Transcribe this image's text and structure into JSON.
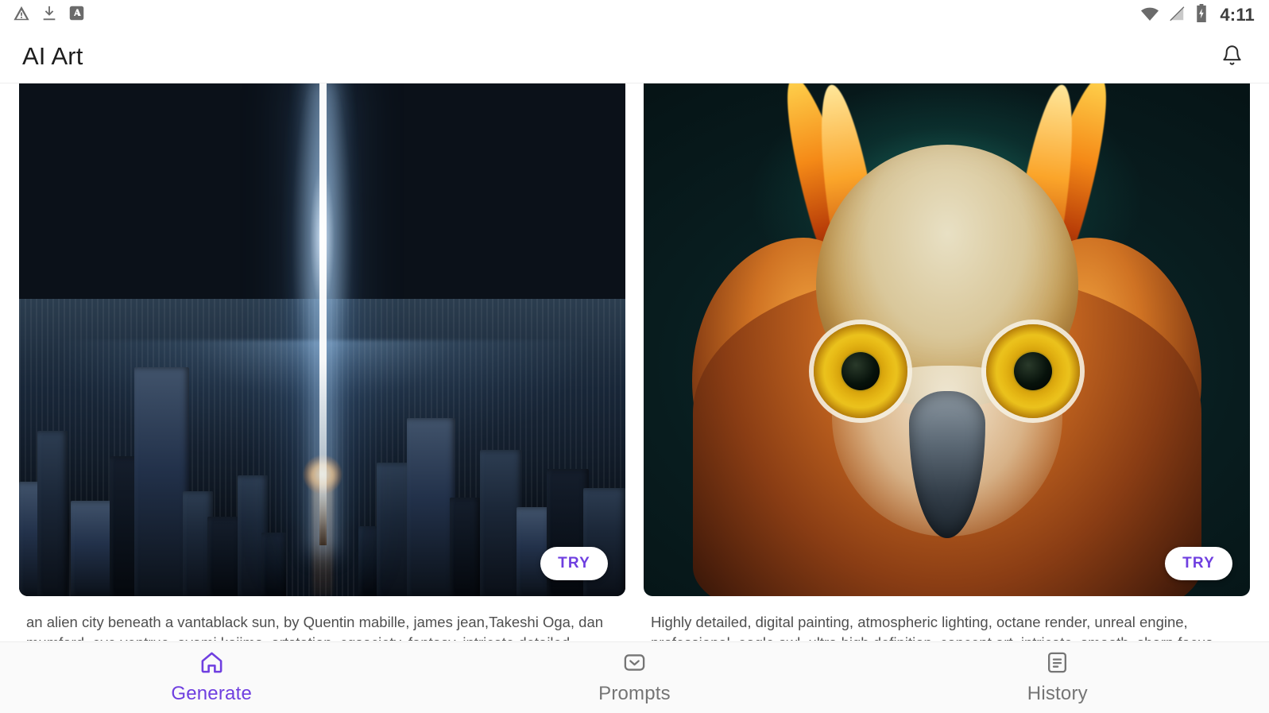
{
  "status_bar": {
    "left_icons": [
      {
        "name": "warning-triangle-icon",
        "label": "warning"
      },
      {
        "name": "download-icon",
        "label": "download"
      },
      {
        "name": "app-a-icon",
        "label": "A"
      }
    ],
    "right_icons": [
      {
        "name": "wifi-icon",
        "label": "wifi"
      },
      {
        "name": "no-signal-icon",
        "label": "no signal"
      },
      {
        "name": "battery-charging-icon",
        "label": "battery charging"
      }
    ],
    "time": "4:11"
  },
  "app_bar": {
    "title": "AI Art",
    "notification_icon": "bell-icon"
  },
  "gallery": {
    "cards": [
      {
        "id": "alien-city",
        "alt": "an alien city beneath a vantablack sun with a vertical beam of light",
        "try_label": "TRY",
        "caption": "an alien city beneath a vantablack sun, by Quentin mabille, james jean,Takeshi Oga, dan mumford, eve ventrue, ayami kojima, artstation, cgsociety, fantasy, intricate detailed, scaffolding"
      },
      {
        "id": "eagle-owl",
        "alt": "highly detailed digital painting of an eagle owl",
        "try_label": "TRY",
        "caption": "Highly detailed, digital painting, atmospheric lighting, octane render, unreal engine, professional, eagle owl, ultra high definition, concept art, intricate, smooth, sharp focus, illustration"
      }
    ]
  },
  "bottom_nav": {
    "items": [
      {
        "id": "generate",
        "label": "Generate",
        "icon": "home-icon",
        "active": true
      },
      {
        "id": "prompts",
        "label": "Prompts",
        "icon": "chevron-box-icon",
        "active": false
      },
      {
        "id": "history",
        "label": "History",
        "icon": "document-list-icon",
        "active": false
      }
    ]
  },
  "colors": {
    "accent_purple": "#6f3fe0",
    "inactive_gray": "#757575",
    "caption_gray": "#4f4f4f",
    "nav_background": "#fafafa"
  }
}
